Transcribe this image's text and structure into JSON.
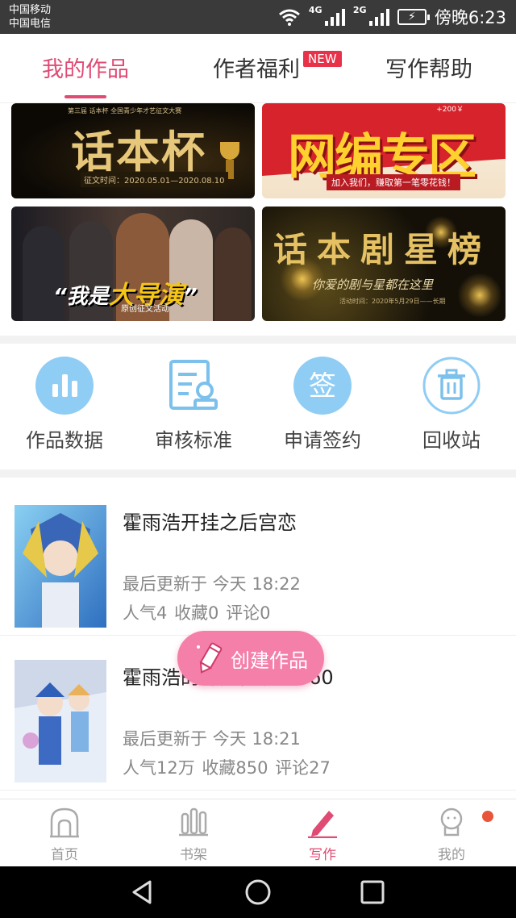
{
  "status_bar": {
    "carrier_1": "中国移动",
    "carrier_2": "中国电信",
    "net_1": "4G",
    "net_2": "2G",
    "time": "傍晚6:23"
  },
  "tabs": [
    {
      "label": "我的作品",
      "active": true
    },
    {
      "label": "作者福利",
      "active": false,
      "badge": "NEW"
    },
    {
      "label": "写作帮助",
      "active": false
    }
  ],
  "banners": {
    "b1": {
      "top": "第三届  话本杯  全国青少年才艺征文大赛",
      "title": "话本杯",
      "sub": "征文时间：2020.05.01—2020.08.10"
    },
    "b2": {
      "amount": "+200￥",
      "title": "网编专区",
      "sub": "加入我们，赚取第一笔零花钱！"
    },
    "b3": {
      "title_pre": "“我是",
      "title_main": "大导演",
      "title_post": "”",
      "sub": "原创征文活动"
    },
    "b4": {
      "title": "话本剧星榜",
      "sub": "你爱的剧与星都在这里",
      "date": "活动时间：2020年5月29日——长期"
    }
  },
  "quick": [
    {
      "label": "作品数据",
      "icon": "bar-chart-icon"
    },
    {
      "label": "审核标准",
      "icon": "review-document-icon"
    },
    {
      "label": "申请签约",
      "icon": "sign-contract-icon"
    },
    {
      "label": "回收站",
      "icon": "trash-icon"
    }
  ],
  "works": [
    {
      "title": "霍雨浩开挂之后宫恋",
      "update": "最后更新于 今天 18:22",
      "stats": "人气4 收藏0 评论0"
    },
    {
      "title": "霍雨浩的斗罗传说-d060",
      "update": "最后更新于 今天 18:21",
      "stats": "人气12万 收藏850 评论27"
    }
  ],
  "fab": {
    "label": "创建作品",
    "icon": "pencil-icon"
  },
  "bottom_nav": [
    {
      "label": "首页",
      "icon": "home-icon",
      "active": false
    },
    {
      "label": "书架",
      "icon": "bookshelf-icon",
      "active": false
    },
    {
      "label": "写作",
      "icon": "pen-icon",
      "active": true
    },
    {
      "label": "我的",
      "icon": "profile-icon",
      "active": false
    }
  ],
  "colors": {
    "accent": "#e04b74",
    "fab": "#f47fa9",
    "icon_blue": "#4aa8e6",
    "badge_red": "#e8324a"
  }
}
